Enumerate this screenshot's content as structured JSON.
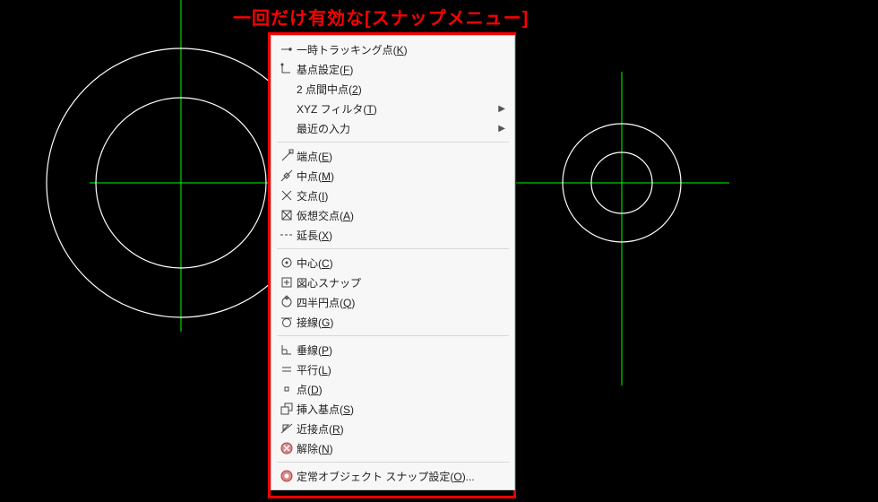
{
  "title": "一回だけ有効な[スナップメニュー]",
  "menu": {
    "group1": [
      {
        "icon": "arrow-flat",
        "label": "一時トラッキング点",
        "key": "K"
      },
      {
        "icon": "corner",
        "label": "基点設定",
        "key": "F"
      },
      {
        "icon": "",
        "label": "2 点間中点",
        "key": "2"
      },
      {
        "icon": "",
        "label": "XYZ フィルタ",
        "key": "T",
        "submenu": true
      },
      {
        "icon": "",
        "label": "最近の入力",
        "key": "",
        "submenu": true
      }
    ],
    "group2": [
      {
        "icon": "diag-end",
        "label": "端点",
        "key": "E"
      },
      {
        "icon": "diag-mid",
        "label": "中点",
        "key": "M"
      },
      {
        "icon": "x",
        "label": "交点",
        "key": "I"
      },
      {
        "icon": "x-box",
        "label": "仮想交点",
        "key": "A"
      },
      {
        "icon": "dashline",
        "label": "延長",
        "key": "X"
      }
    ],
    "group3": [
      {
        "icon": "circle-dot",
        "label": "中心",
        "key": "C"
      },
      {
        "icon": "centroid",
        "label": "図心スナップ",
        "key": ""
      },
      {
        "icon": "circle-diamond",
        "label": "四半円点",
        "key": "Q"
      },
      {
        "icon": "circle-tan",
        "label": "接線",
        "key": "G"
      }
    ],
    "group4": [
      {
        "icon": "perp",
        "label": "垂線",
        "key": "P"
      },
      {
        "icon": "parallel",
        "label": "平行",
        "key": "L"
      },
      {
        "icon": "dot",
        "label": "点",
        "key": "D"
      },
      {
        "icon": "insert",
        "label": "挿入基点",
        "key": "S"
      },
      {
        "icon": "near",
        "label": "近接点",
        "key": "R"
      },
      {
        "icon": "none",
        "label": "解除",
        "key": "N"
      }
    ],
    "group5": [
      {
        "icon": "settings",
        "label": "定常オブジェクト スナップ設定",
        "key": "O",
        "ellipsis": true
      }
    ]
  },
  "submenu_arrow": "▶"
}
